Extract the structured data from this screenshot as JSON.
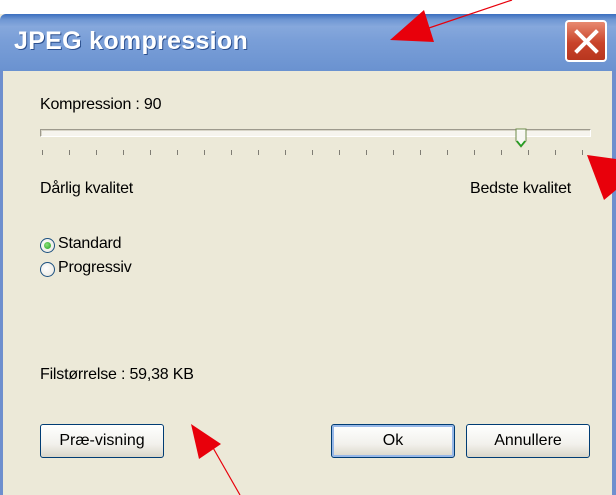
{
  "window": {
    "title": "JPEG kompression"
  },
  "compression": {
    "label": "Kompression : 90",
    "value": 90,
    "min": 0,
    "max": 100,
    "min_label": "Dårlig kvalitet",
    "max_label": "Bedste kvalitet"
  },
  "mode": {
    "options": [
      {
        "label": "Standard",
        "selected": true
      },
      {
        "label": "Progressiv",
        "selected": false
      }
    ]
  },
  "file_size": {
    "label": "Filstørrelse : 59,38 KB"
  },
  "buttons": {
    "preview": "Præ-visning",
    "ok": "Ok",
    "cancel": "Annullere"
  },
  "icons": {
    "close": "close-icon",
    "annotation": "red-arrow-icon"
  },
  "colors": {
    "title_bar": "#6f97d3",
    "close_button": "#c9432a",
    "dialog_bg": "#ece9d8",
    "annotation_arrow": "#e8000b",
    "radio_selected": "#21a121"
  }
}
